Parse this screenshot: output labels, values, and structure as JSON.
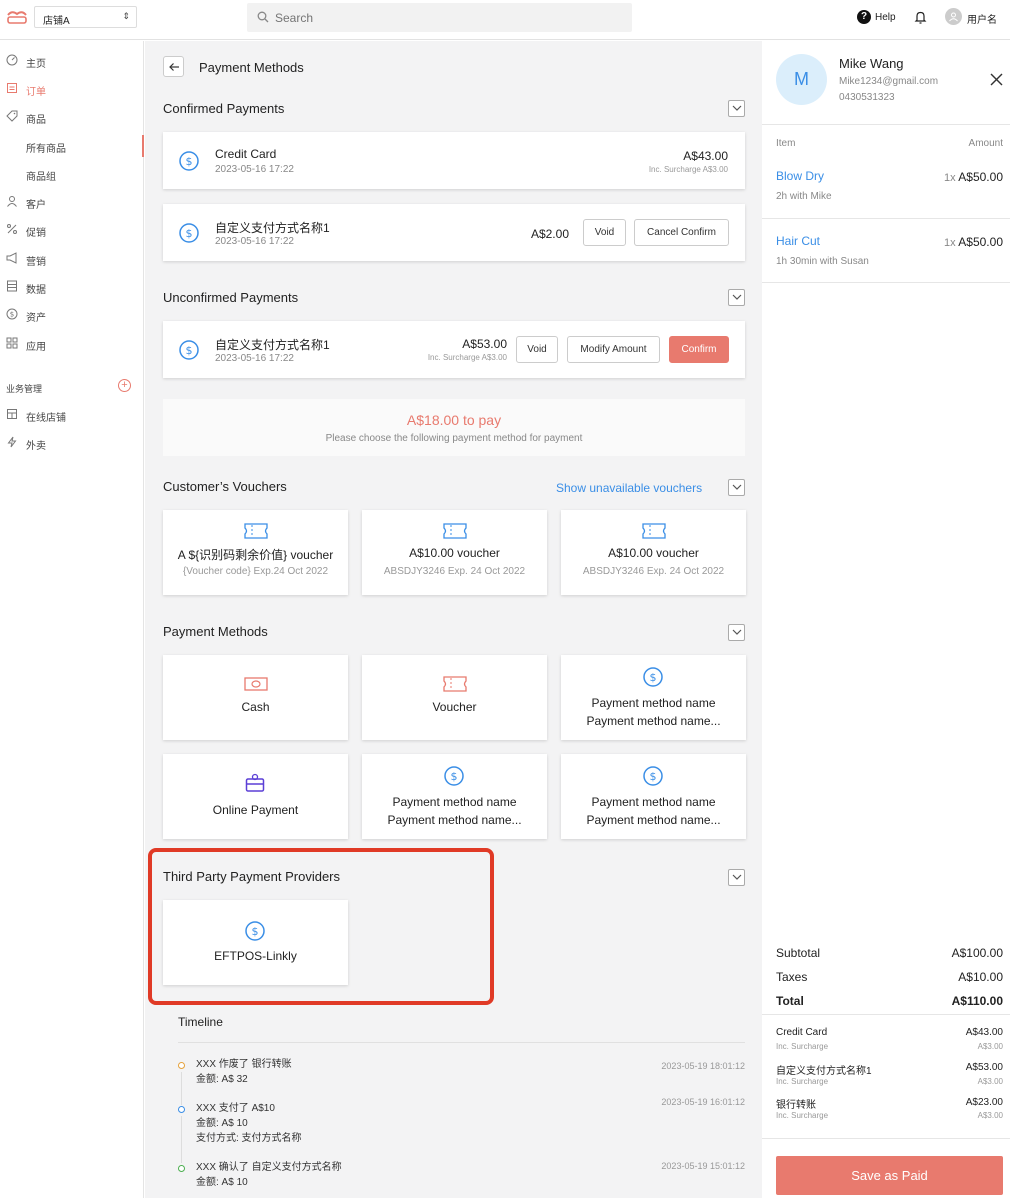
{
  "topbar": {
    "store": "店铺A",
    "search_placeholder": "Search",
    "help": "Help",
    "user_name": "用户名"
  },
  "sidebar": {
    "items": [
      {
        "label": "主页",
        "icon": "dashboard-icon"
      },
      {
        "label": "订单",
        "icon": "orders-icon"
      },
      {
        "label": "商品",
        "icon": "tag-icon"
      },
      {
        "label": "所有商品"
      },
      {
        "label": "商品组"
      },
      {
        "label": "客户",
        "icon": "user-icon"
      },
      {
        "label": "促销",
        "icon": "percent-icon"
      },
      {
        "label": "营销",
        "icon": "megaphone-icon"
      },
      {
        "label": "数据",
        "icon": "data-icon"
      },
      {
        "label": "资产",
        "icon": "coin-icon"
      },
      {
        "label": "应用",
        "icon": "apps-icon"
      }
    ],
    "section": "业务管理",
    "section_items": [
      {
        "label": "在线店铺",
        "icon": "store-icon"
      },
      {
        "label": "外卖",
        "icon": "lightning-icon"
      }
    ],
    "accent": "#e87a6e"
  },
  "main": {
    "title": "Payment Methods",
    "confirmed": {
      "title": "Confirmed Payments",
      "rows": [
        {
          "name": "Credit Card",
          "date": "2023-05-16 17:22",
          "amount": "A$43.00",
          "surcharge": "Inc. Surcharge A$3.00"
        },
        {
          "name": "自定义支付方式名称1",
          "date": "2023-05-16 17:22",
          "amount": "A$2.00",
          "void": "Void",
          "cancel": "Cancel Confirm"
        }
      ]
    },
    "unconfirmed": {
      "title": "Unconfirmed Payments",
      "rows": [
        {
          "name": "自定义支付方式名称1",
          "date": "2023-05-16 17:22",
          "amount": "A$53.00",
          "surcharge": "Inc. Surcharge A$3.00",
          "void": "Void",
          "modify": "Modify Amount",
          "confirm": "Confirm"
        }
      ]
    },
    "to_pay": {
      "amount": "A$18.00 to pay",
      "hint": "Please choose the following payment method for payment"
    },
    "vouchers": {
      "title": "Customer’s Vouchers",
      "link": "Show unavailable vouchers",
      "items": [
        {
          "title": "A ${识别码剩余价值} voucher",
          "sub": "{Voucher code} Exp.24 Oct 2022"
        },
        {
          "title": "A$10.00 voucher",
          "sub": "ABSDJY3246 Exp. 24 Oct 2022"
        },
        {
          "title": "A$10.00 voucher",
          "sub": "ABSDJY3246 Exp. 24 Oct 2022"
        }
      ]
    },
    "methods": {
      "title": "Payment Methods",
      "items": [
        {
          "l1": "Cash",
          "icon": "cash-icon"
        },
        {
          "l1": "Voucher",
          "icon": "voucher-icon"
        },
        {
          "l1": "Payment method name",
          "l2": "Payment method name...",
          "icon": "dollar-icon"
        },
        {
          "l1": "Online Payment",
          "icon": "online-payment-icon"
        },
        {
          "l1": "Payment method name",
          "l2": "Payment method name...",
          "icon": "dollar-icon"
        },
        {
          "l1": "Payment method name",
          "l2": "Payment method name...",
          "icon": "dollar-icon"
        }
      ]
    },
    "third_party": {
      "title": "Third Party Payment Providers",
      "items": [
        {
          "l1": "EFTPOS-Linkly",
          "icon": "dollar-icon"
        }
      ]
    },
    "timeline": {
      "title": "Timeline",
      "entries": [
        {
          "line1": "XXX 作废了 银行转账",
          "line2": "金额: A$ 32",
          "date": "2023-05-19 18:01:12",
          "color": "#e6a23c"
        },
        {
          "line1": "XXX 支付了 A$10",
          "line2": "金额: A$ 10",
          "line3": "支付方式: 支付方式名称",
          "date": "2023-05-19 16:01:12",
          "color": "#3a8ee6"
        },
        {
          "line1": "XXX 确认了 自定义支付方式名称",
          "line2": "金额: A$ 10",
          "date": "2023-05-19 15:01:12",
          "color": "#4caf50"
        }
      ]
    }
  },
  "customer": {
    "initial": "M",
    "name": "Mike Wang",
    "email": "Mike1234@gmail.com",
    "phone": "0430531323"
  },
  "items_header": {
    "item": "Item",
    "amount": "Amount"
  },
  "services": [
    {
      "name": "Blow Dry",
      "sub": "2h with Mike",
      "qty": "1x",
      "amount": "A$50.00"
    },
    {
      "name": "Hair Cut",
      "sub": "1h 30min with Susan",
      "qty": "1x",
      "amount": "A$50.00"
    }
  ],
  "totals": {
    "subtotal_label": "Subtotal",
    "subtotal": "A$100.00",
    "taxes_label": "Taxes",
    "taxes": "A$10.00",
    "total_label": "Total",
    "total": "A$110.00"
  },
  "payments_summary": [
    {
      "name": "Credit Card",
      "sub": "Inc. Surcharge",
      "amount": "A$43.00",
      "sub_amount": "A$3.00"
    },
    {
      "name": "自定义支付方式名称1",
      "sub": "Inc. Surcharge",
      "amount": "A$53.00",
      "sub_amount": "A$3.00"
    },
    {
      "name": "银行转账",
      "sub": "Inc. Surcharge",
      "amount": "A$23.00",
      "sub_amount": "A$3.00"
    }
  ],
  "save_button": "Save as Paid"
}
